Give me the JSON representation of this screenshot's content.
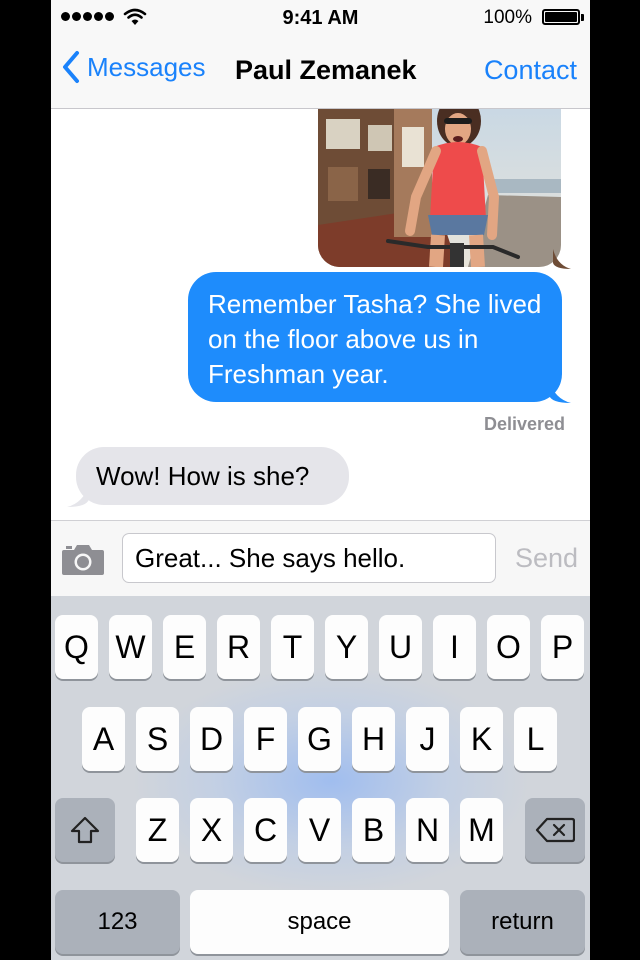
{
  "status": {
    "time": "9:41 AM",
    "battery": "100%"
  },
  "nav": {
    "back_label": "Messages",
    "title": "Paul Zemanek",
    "contact_label": "Contact"
  },
  "thread": {
    "outgoing_text": "Remember Tasha? She lived on the floor above us in Freshman year.",
    "status": "Delivered",
    "incoming_text": "Wow! How is she?"
  },
  "compose": {
    "value": "Great... She says hello.",
    "send_label": "Send"
  },
  "keyboard": {
    "row1": [
      "Q",
      "W",
      "E",
      "R",
      "T",
      "Y",
      "U",
      "I",
      "O",
      "P"
    ],
    "row2": [
      "A",
      "S",
      "D",
      "F",
      "G",
      "H",
      "J",
      "K",
      "L"
    ],
    "row3": [
      "Z",
      "X",
      "C",
      "V",
      "B",
      "N",
      "M"
    ],
    "numbers_label": "123",
    "space_label": "space",
    "return_label": "return"
  },
  "colors": {
    "accent": "#1a82fb",
    "outgoing_bubble": "#1e8cfc",
    "incoming_bubble": "#e5e5ea"
  },
  "icons": [
    "back-chevron-icon",
    "camera-icon",
    "shift-icon",
    "delete-icon",
    "wifi-icon",
    "battery-icon"
  ]
}
